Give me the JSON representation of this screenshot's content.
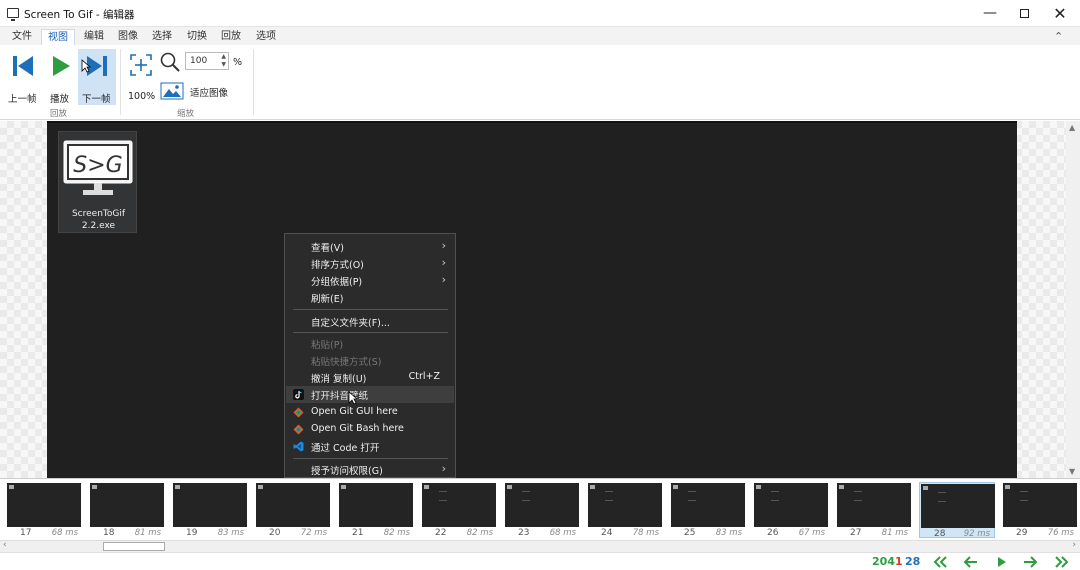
{
  "window": {
    "title": "Screen To Gif - 编辑器",
    "min_glyph": "—",
    "close_glyph": "✕"
  },
  "ribbon_tabs": [
    "文件",
    "视图",
    "编辑",
    "图像",
    "选择",
    "切换",
    "回放",
    "选项"
  ],
  "ribbon_active_tab": "视图",
  "ribbon": {
    "playback": {
      "prev_label": "上一帧",
      "play_label": "播放",
      "next_label": "下一帧",
      "group_label": "回放"
    },
    "zoom": {
      "reset_label": "100%",
      "zoom_value": "100",
      "zoom_unit": "%",
      "fit_label": "适应图像",
      "group_label": "缩放"
    }
  },
  "desktop_icon": {
    "name_line1": "ScreenToGif",
    "name_line2": "2.2.exe",
    "logo_text": "S>G"
  },
  "context_menu": {
    "items": [
      {
        "label": "查看(V)",
        "submenu": true
      },
      {
        "label": "排序方式(O)",
        "submenu": true
      },
      {
        "label": "分组依据(P)",
        "submenu": true
      },
      {
        "label": "刷新(E)"
      },
      {
        "label": "自定义文件夹(F)..."
      },
      {
        "label": "粘贴(P)",
        "disabled": true
      },
      {
        "label": "粘贴快捷方式(S)",
        "disabled": true
      },
      {
        "label": "撤消 复制(U)",
        "shortcut": "Ctrl+Z"
      },
      {
        "label": "打开抖音壁纸",
        "icon": "tiktok-icon"
      },
      {
        "label": "Open Git GUI here",
        "icon": "git-icon"
      },
      {
        "label": "Open Git Bash here",
        "icon": "git-icon"
      },
      {
        "label": "通过 Code 打开",
        "icon": "vscode-icon"
      },
      {
        "label": "授予访问权限(G)",
        "submenu": true
      }
    ],
    "submenu_glyph": "›"
  },
  "frames": [
    {
      "number": "17",
      "duration": "68 ms"
    },
    {
      "number": "18",
      "duration": "81 ms"
    },
    {
      "number": "19",
      "duration": "83 ms"
    },
    {
      "number": "20",
      "duration": "72 ms"
    },
    {
      "number": "21",
      "duration": "82 ms"
    },
    {
      "number": "22",
      "duration": "82 ms"
    },
    {
      "number": "23",
      "duration": "68 ms"
    },
    {
      "number": "24",
      "duration": "78 ms"
    },
    {
      "number": "25",
      "duration": "83 ms"
    },
    {
      "number": "26",
      "duration": "67 ms"
    },
    {
      "number": "27",
      "duration": "81 ms"
    },
    {
      "number": "28",
      "duration": "92 ms",
      "selected": true
    },
    {
      "number": "29",
      "duration": "76 ms"
    }
  ],
  "status": {
    "total_frames": "204",
    "selected_count": "1",
    "current_frame": "28",
    "colors": {
      "total": "#2f9d3f",
      "selected": "#d33b2c",
      "current": "#1f6fc0"
    }
  },
  "colors": {
    "nav_green": "#2f9d3f",
    "icon_blue": "#1d6fb8"
  }
}
